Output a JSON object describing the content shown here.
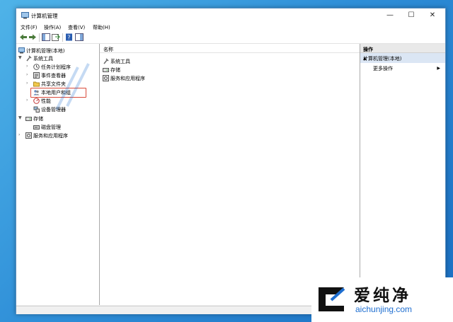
{
  "window": {
    "title": "计算机管理",
    "minimize": "—",
    "maximize": "☐",
    "close": "✕"
  },
  "menu": [
    "文件(F)",
    "操作(A)",
    "查看(V)",
    "帮助(H)"
  ],
  "tree": {
    "root": "计算机管理(本地)",
    "system_tools": "系统工具",
    "task_scheduler": "任务计划程序",
    "event_viewer": "事件查看器",
    "shared_folders": "共享文件夹",
    "local_users": "本地用户和组",
    "performance": "性能",
    "device_manager": "设备管理器",
    "storage": "存储",
    "disk_management": "磁盘管理",
    "services_apps": "服务和应用程序"
  },
  "center": {
    "column_name": "名称",
    "items": [
      "系统工具",
      "存储",
      "服务和应用程序"
    ]
  },
  "actions": {
    "header": "操作",
    "section": "计算机管理(本地)",
    "more": "更多操作"
  },
  "watermark": {
    "text": "爱纯净",
    "url": "aichunjing.com"
  }
}
